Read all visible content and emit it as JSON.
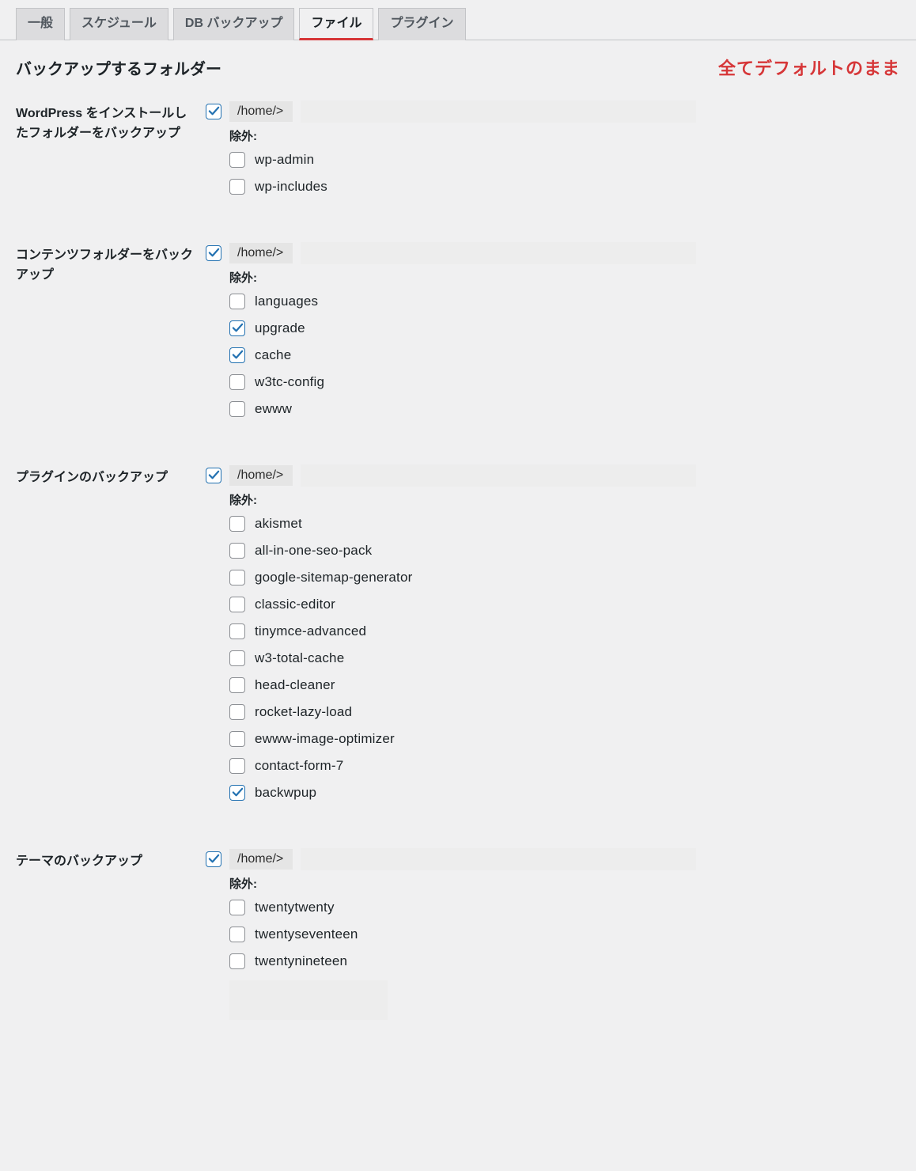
{
  "tabs": [
    {
      "label": "一般",
      "active": false
    },
    {
      "label": "スケジュール",
      "active": false
    },
    {
      "label": "DB バックアップ",
      "active": false
    },
    {
      "label": "ファイル",
      "active": true
    },
    {
      "label": "プラグイン",
      "active": false
    }
  ],
  "heading": "バックアップするフォルダー",
  "annotation": "全てデフォルトのまま",
  "sections": [
    {
      "title": "WordPress をインストールしたフォルダーをバックアップ",
      "enabled": true,
      "path": "/home/>",
      "exclude_label": "除外:",
      "excludes": [
        {
          "label": "wp-admin",
          "checked": false
        },
        {
          "label": "wp-includes",
          "checked": false
        }
      ],
      "name": "wp-install"
    },
    {
      "title": "コンテンツフォルダーをバックアップ",
      "enabled": true,
      "path": "/home/>",
      "exclude_label": "除外:",
      "excludes": [
        {
          "label": "languages",
          "checked": false
        },
        {
          "label": "upgrade",
          "checked": true
        },
        {
          "label": "cache",
          "checked": true
        },
        {
          "label": "w3tc-config",
          "checked": false
        },
        {
          "label": "ewww",
          "checked": false
        }
      ],
      "name": "content"
    },
    {
      "title": "プラグインのバックアップ",
      "enabled": true,
      "path": "/home/>",
      "exclude_label": "除外:",
      "excludes": [
        {
          "label": "akismet",
          "checked": false
        },
        {
          "label": "all-in-one-seo-pack",
          "checked": false
        },
        {
          "label": "google-sitemap-generator",
          "checked": false
        },
        {
          "label": "classic-editor",
          "checked": false
        },
        {
          "label": "tinymce-advanced",
          "checked": false
        },
        {
          "label": "w3-total-cache",
          "checked": false
        },
        {
          "label": "head-cleaner",
          "checked": false
        },
        {
          "label": "rocket-lazy-load",
          "checked": false
        },
        {
          "label": "ewww-image-optimizer",
          "checked": false
        },
        {
          "label": "contact-form-7",
          "checked": false
        },
        {
          "label": "backwpup",
          "checked": true
        }
      ],
      "name": "plugins"
    },
    {
      "title": "テーマのバックアップ",
      "enabled": true,
      "path": "/home/>",
      "exclude_label": "除外:",
      "excludes": [
        {
          "label": "twentytwenty",
          "checked": false
        },
        {
          "label": "twentyseventeen",
          "checked": false
        },
        {
          "label": "twentynineteen",
          "checked": false
        }
      ],
      "name": "themes",
      "has_extra_box": true
    }
  ]
}
